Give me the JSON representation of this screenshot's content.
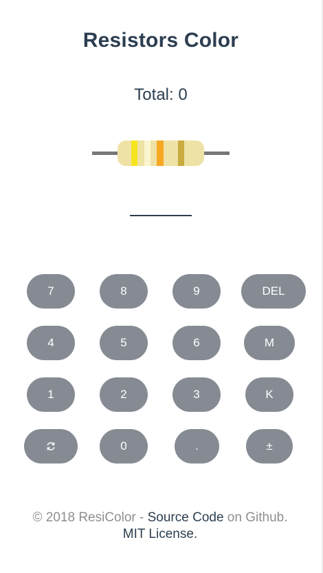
{
  "app": {
    "title": "Resistors Color",
    "total_text": "Total: 0"
  },
  "resistor": {
    "body_color": "#efe2a6",
    "lead_color": "#777777",
    "bands": [
      {
        "name": "band-1",
        "color": "#f6e51e"
      },
      {
        "name": "band-2",
        "color": "#fbf5cf"
      },
      {
        "name": "band-3",
        "color": "#f7a823"
      },
      {
        "name": "band-4",
        "color": "#c9ab3f"
      }
    ]
  },
  "keypad": {
    "row1": [
      "7",
      "8",
      "9",
      "DEL"
    ],
    "row2": [
      "4",
      "5",
      "6",
      "M"
    ],
    "row3": [
      "1",
      "2",
      "3",
      "K"
    ],
    "row4": [
      "",
      "0",
      ".",
      "±"
    ],
    "reset_icon": "refresh-icon",
    "key_color": "#868b93"
  },
  "footer": {
    "copyright": "© 2018 ResiColor - ",
    "source_link": "Source Code",
    "on_github": " on Github.",
    "license_link": "MIT License."
  }
}
